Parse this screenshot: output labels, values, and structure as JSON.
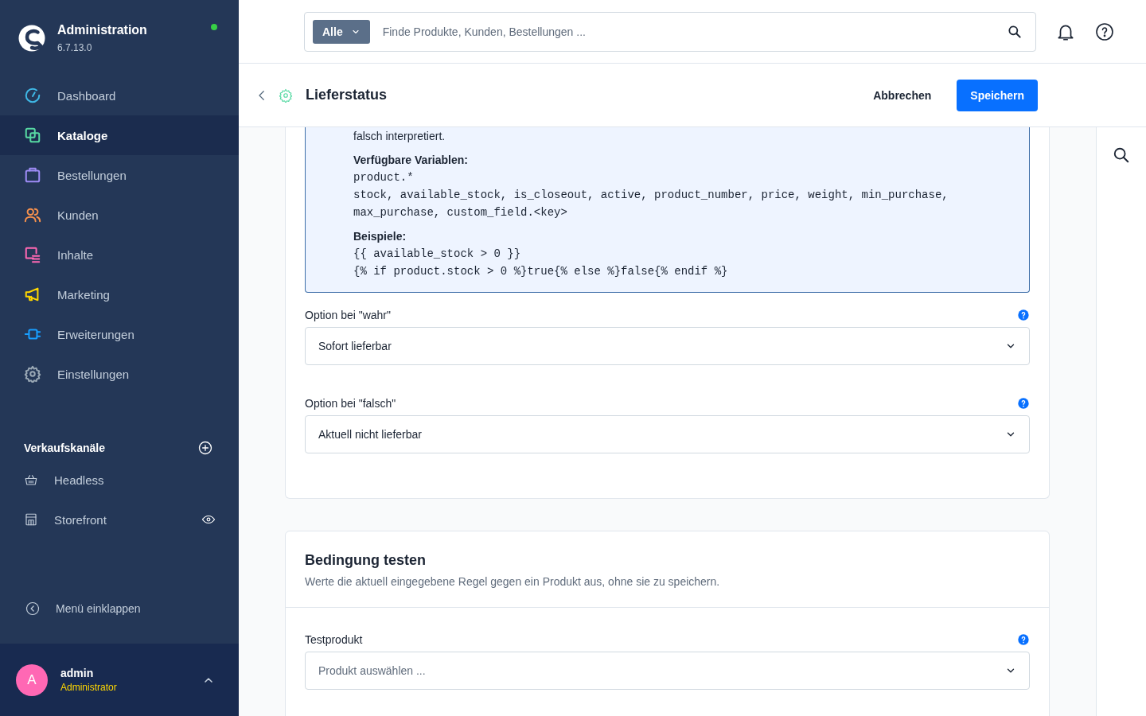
{
  "sidebar": {
    "brand": {
      "title": "Administration",
      "version": "6.7.13.0",
      "online": true
    },
    "items": [
      {
        "label": "Dashboard",
        "kind": "dashboard",
        "color": "#3fb8e6",
        "selected": false
      },
      {
        "label": "Kataloge",
        "kind": "catalog",
        "color": "#57d9a3",
        "selected": true
      },
      {
        "label": "Bestellungen",
        "kind": "orders",
        "color": "#9e8cf6",
        "selected": false
      },
      {
        "label": "Kunden",
        "kind": "customers",
        "color": "#f7914d",
        "selected": false
      },
      {
        "label": "Inhalte",
        "kind": "content",
        "color": "#ff68b4",
        "selected": false
      },
      {
        "label": "Marketing",
        "kind": "marketing",
        "color": "#ffd700",
        "selected": false
      },
      {
        "label": "Erweiterungen",
        "kind": "extensions",
        "color": "#189eff",
        "selected": false
      },
      {
        "label": "Einstellungen",
        "kind": "settings",
        "color": "#9aa8b5",
        "selected": false
      }
    ],
    "sales_channels": {
      "title": "Verkaufskanäle",
      "items": [
        {
          "label": "Headless",
          "kind": "basket",
          "preview": false
        },
        {
          "label": "Storefront",
          "kind": "store",
          "preview": true
        }
      ]
    },
    "collapse": "Menü einklappen",
    "user": {
      "initial": "A",
      "name": "admin",
      "role": "Administrator"
    }
  },
  "search": {
    "scope": "Alle",
    "placeholder": "Finde Produkte, Kunden, Bestellungen ..."
  },
  "page": {
    "title": "Lieferstatus",
    "cancel": "Abbrechen",
    "save": "Speichern"
  },
  "help_box": {
    "cut_line": "falsch interpretiert.",
    "sections": [
      {
        "heading": "Verfügbare Variablen:",
        "lines": [
          "product.*",
          "stock, available_stock, is_closeout, active, product_number, price, weight, min_purchase,",
          "max_purchase, custom_field.<key>"
        ]
      },
      {
        "heading": "Beispiele:",
        "lines": [
          "{{ available_stock > 0 }}",
          "{% if product.stock > 0 %}true{% else %}false{% endif %}"
        ]
      }
    ]
  },
  "fields": [
    {
      "label": "Option bei \"wahr\"",
      "value": "Sofort lieferbar"
    },
    {
      "label": "Option bei \"falsch\"",
      "value": "Aktuell nicht lieferbar"
    }
  ],
  "test_card": {
    "title": "Bedingung testen",
    "subtitle": "Werte die aktuell eingegebene Regel gegen ein Produkt aus, ohne sie zu speichern.",
    "field": {
      "label": "Testprodukt",
      "placeholder": "Produkt auswählen ..."
    }
  }
}
